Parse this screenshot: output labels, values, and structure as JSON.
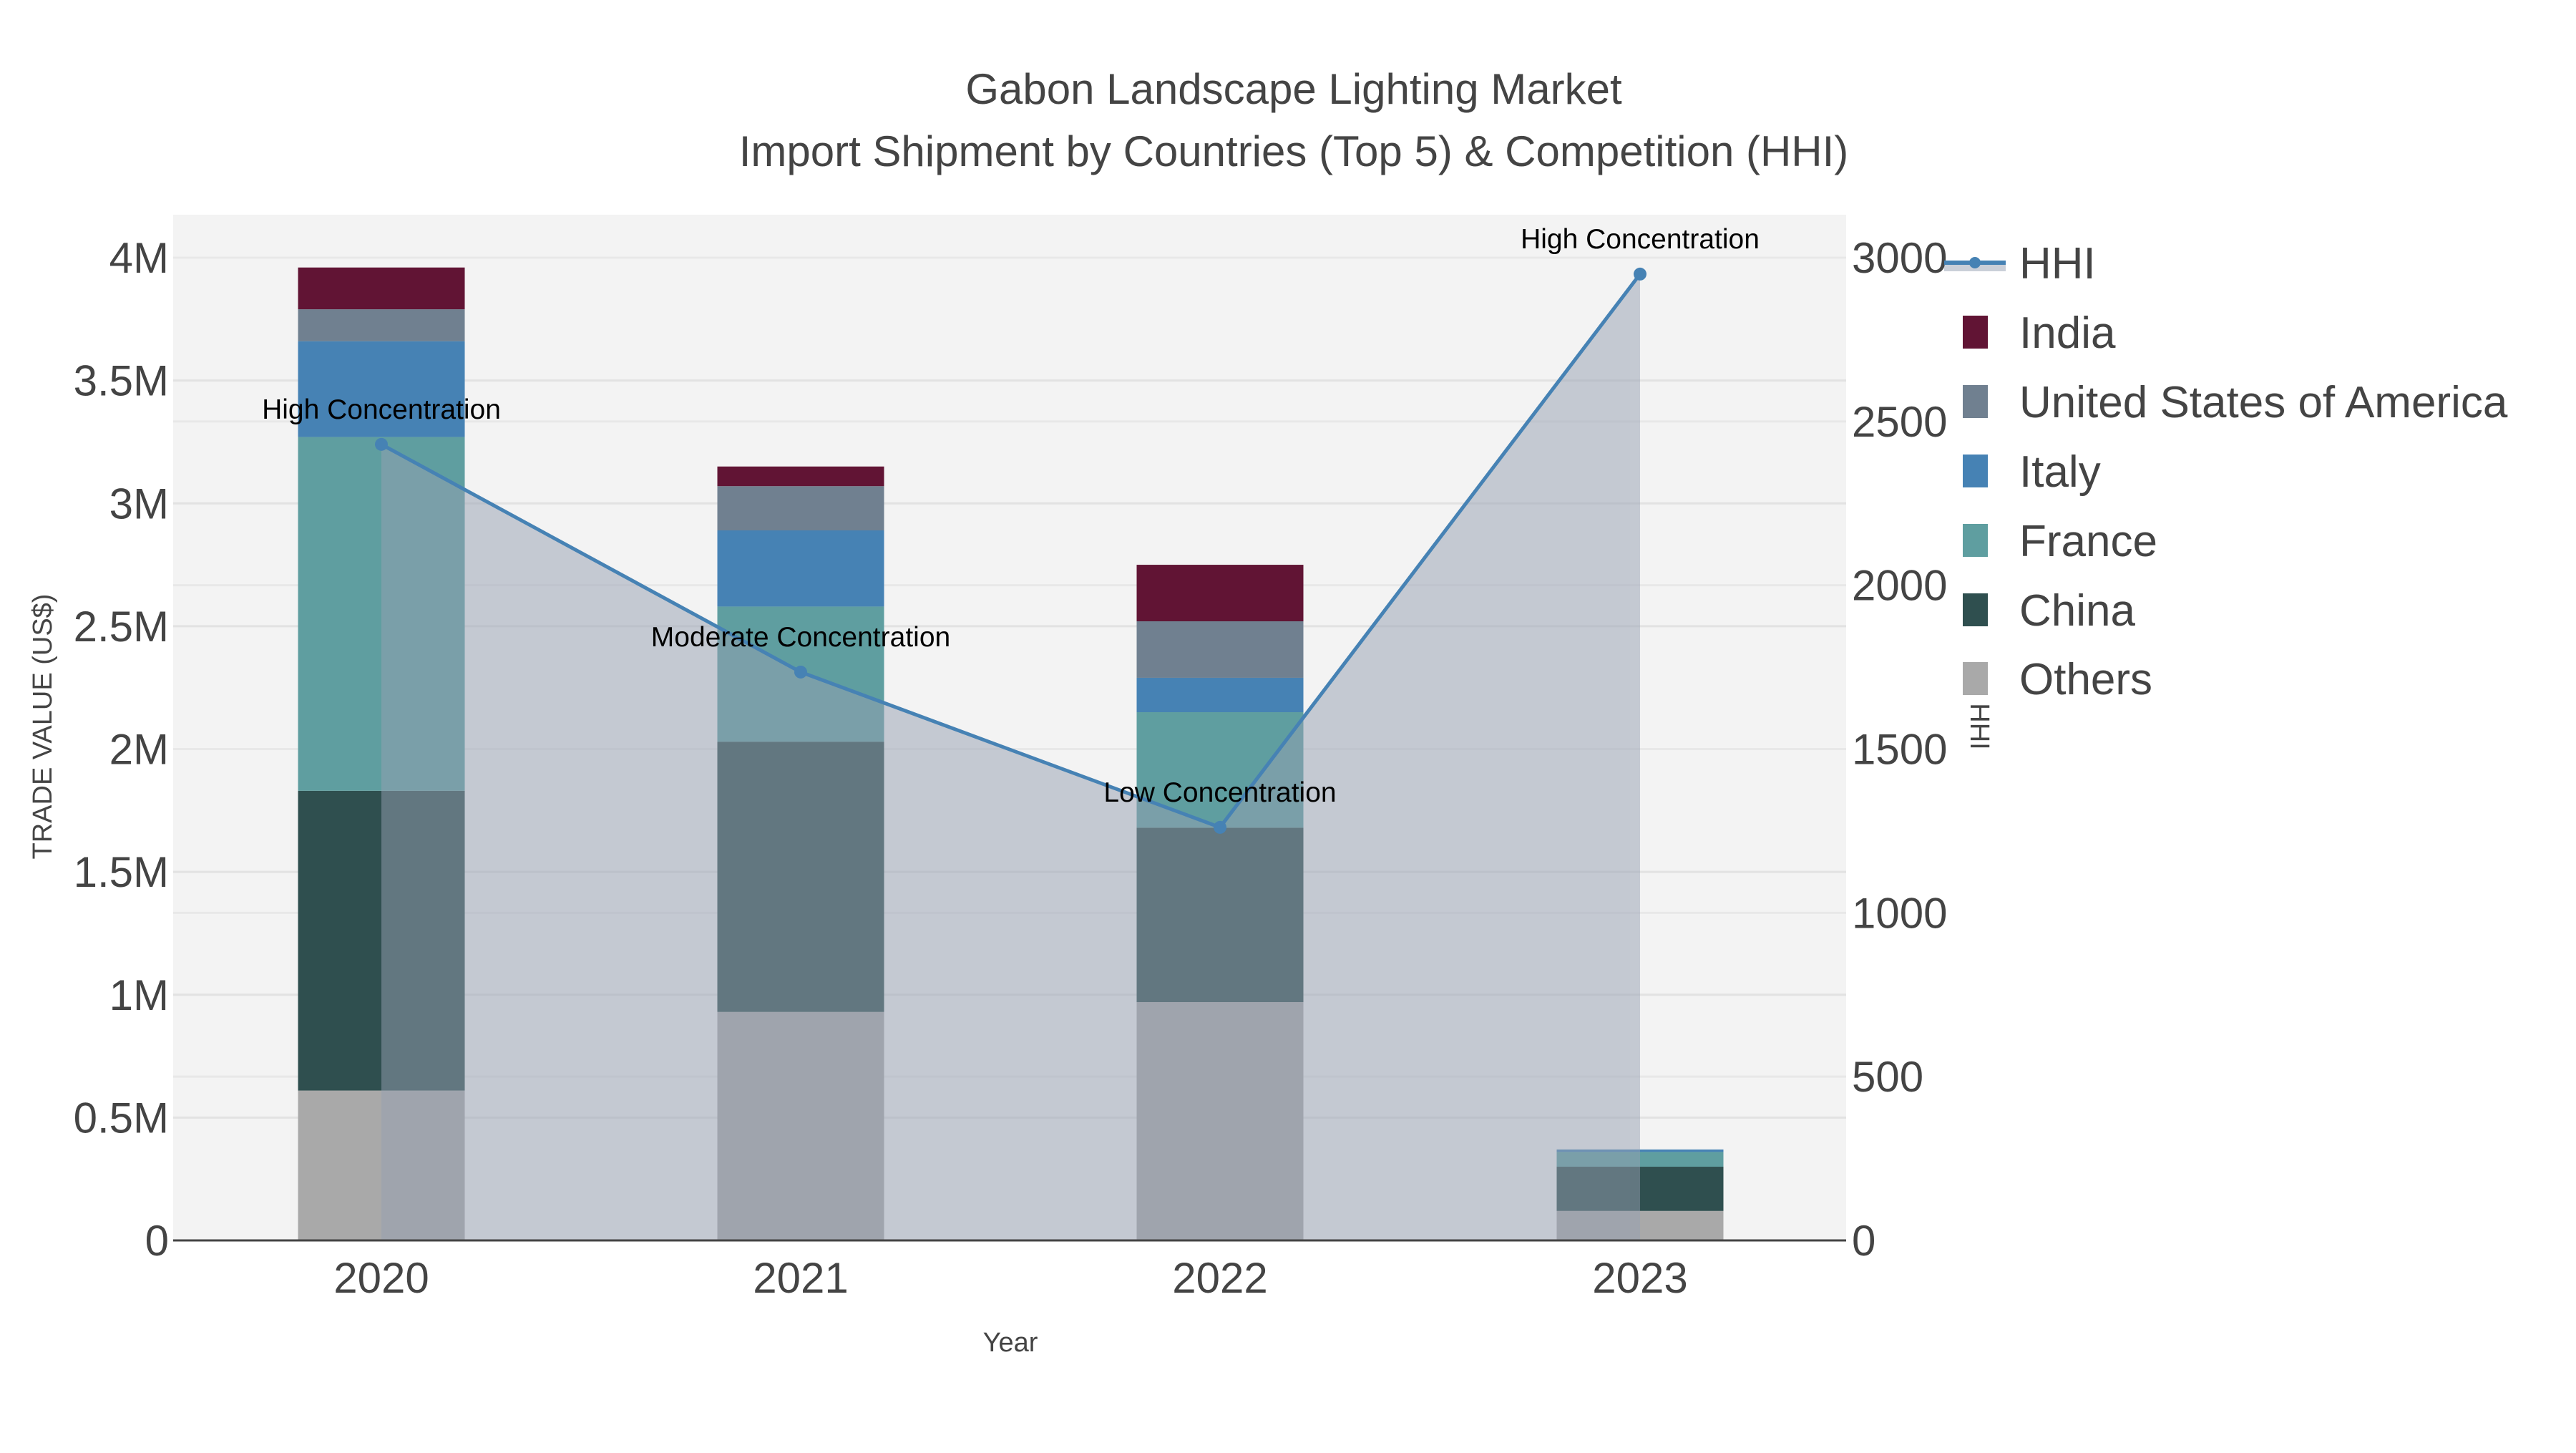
{
  "chart_data": {
    "type": "bar",
    "title": "Gabon Landscape Lighting Market",
    "subtitle": "Import Shipment by Countries (Top 5) & Competition (HHI)",
    "xlabel": "Year",
    "ylabel": "TRADE VALUE (US$)",
    "y2label": "HHI",
    "categories": [
      "2020",
      "2021",
      "2022",
      "2023"
    ],
    "ylim": [
      0,
      4.2
    ],
    "y_ticks": [
      0,
      0.5,
      1,
      1.5,
      2,
      2.5,
      3,
      3.5,
      4
    ],
    "y_tick_labels": [
      "0",
      "0.5M",
      "1M",
      "1.5M",
      "2M",
      "2.5M",
      "3M",
      "3.5M",
      "4M"
    ],
    "y2lim": [
      0,
      3150
    ],
    "y2_ticks": [
      0,
      500,
      1000,
      1500,
      2000,
      2500,
      3000
    ],
    "y2_tick_labels": [
      "0",
      "500",
      "1000",
      "1500",
      "2000",
      "2500",
      "3000"
    ],
    "value_unit": "millions US$",
    "series": [
      {
        "name": "Others",
        "color": "#a9a9a9",
        "values": [
          0.61,
          0.93,
          0.97,
          0.12
        ]
      },
      {
        "name": "China",
        "color": "#2f4f4f",
        "values": [
          1.22,
          1.1,
          0.71,
          0.18
        ]
      },
      {
        "name": "France",
        "color": "#5f9ea0",
        "values": [
          1.44,
          0.55,
          0.47,
          0.06
        ]
      },
      {
        "name": "Italy",
        "color": "#4682b4",
        "values": [
          0.39,
          0.31,
          0.14,
          0.01
        ]
      },
      {
        "name": "United States of America",
        "color": "#708090",
        "values": [
          0.13,
          0.18,
          0.23,
          0.0
        ]
      },
      {
        "name": "India",
        "color": "#611434",
        "values": [
          0.17,
          0.08,
          0.23,
          0.0
        ]
      }
    ],
    "hhi": {
      "name": "HHI",
      "color": "#4682b4",
      "values": [
        2430,
        1735,
        1261,
        2950
      ],
      "annotations": [
        "High Concentration",
        "Moderate Concentration",
        "Low Concentration",
        "High Concentration"
      ]
    },
    "legend": [
      "HHI",
      "India",
      "United States of America",
      "Italy",
      "France",
      "China",
      "Others"
    ],
    "legend_placement": "right",
    "grid": true
  }
}
